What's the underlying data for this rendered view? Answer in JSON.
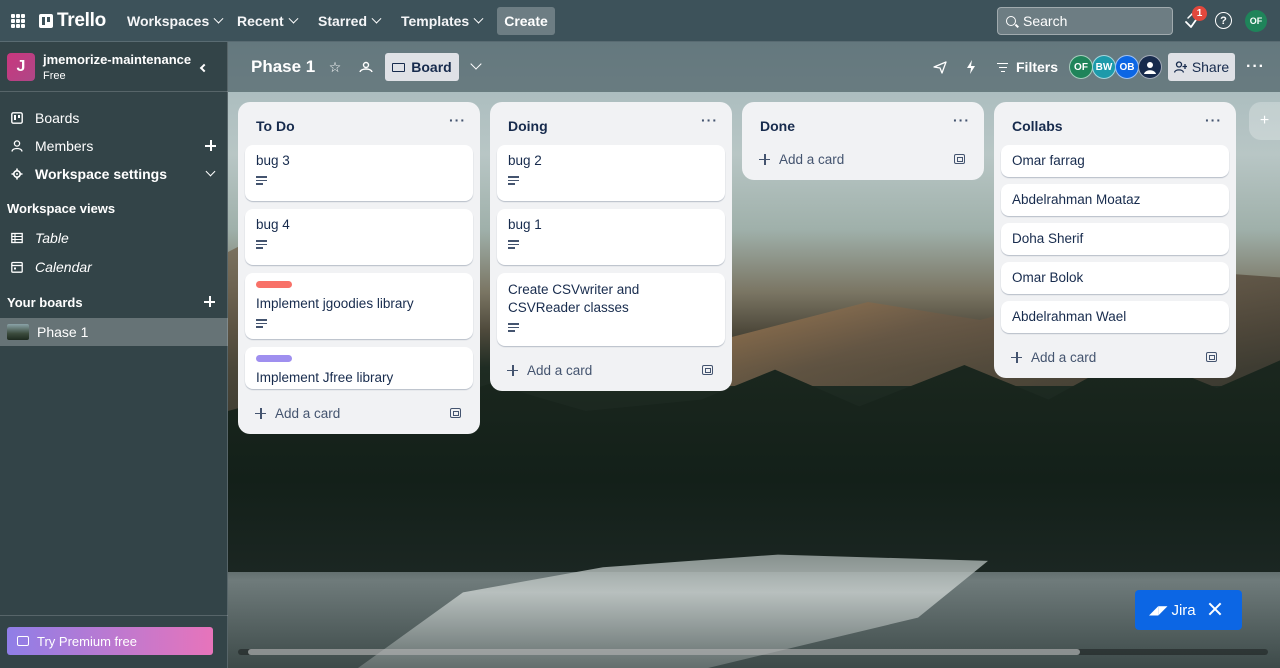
{
  "topbar": {
    "logo": "Trello",
    "menus": [
      "Workspaces",
      "Recent",
      "Starred",
      "Templates"
    ],
    "create_label": "Create",
    "search_placeholder": "Search",
    "notification_count": "1",
    "help_glyph": "?",
    "user_initials": "OF",
    "icons": [
      "apps-grid-icon",
      "trello-logo-icon",
      "search-icon",
      "notification-icon",
      "help-icon"
    ]
  },
  "sidebar": {
    "workspace_initial": "J",
    "workspace_name": "jmemorize-maintenance",
    "workspace_plan": "Free",
    "items": [
      {
        "label": "Boards",
        "icon": "boards-icon"
      },
      {
        "label": "Members",
        "icon": "member-icon"
      },
      {
        "label": "Workspace settings",
        "icon": "gear-icon"
      }
    ],
    "views_heading": "Workspace views",
    "views": [
      {
        "label": "Table",
        "icon": "table-icon"
      },
      {
        "label": "Calendar",
        "icon": "calendar-icon"
      }
    ],
    "your_boards_heading": "Your boards",
    "boards": [
      {
        "label": "Phase 1"
      }
    ],
    "premium_label": "Try Premium free"
  },
  "board_header": {
    "title": "Phase 1",
    "view_label": "Board",
    "filters_label": "Filters",
    "members": [
      {
        "initials": "OF",
        "color": "#1f845a"
      },
      {
        "initials": "BW",
        "color": "#1d9aaa"
      },
      {
        "initials": "OB",
        "color": "#0c66e4"
      },
      {
        "initials": "",
        "color": "#172b4d"
      }
    ],
    "share_label": "Share",
    "more_label": "···"
  },
  "lists": [
    {
      "title": "To Do",
      "menu": "···",
      "cards": [
        {
          "title": "bug 3",
          "has_description": true
        },
        {
          "title": "bug 4",
          "has_description": true
        },
        {
          "title": "Implement jgoodies library",
          "label_color": "#f87168",
          "has_description": true
        },
        {
          "title": "Implement Jfree library",
          "label_color": "#9f8fef",
          "has_description": false
        }
      ],
      "add_card": "Add a card"
    },
    {
      "title": "Doing",
      "menu": "···",
      "cards": [
        {
          "title": "bug 2",
          "has_description": true
        },
        {
          "title": "bug 1",
          "has_description": true
        },
        {
          "title": "Create CSVwriter and CSVReader classes",
          "has_description": true
        }
      ],
      "add_card": "Add a card"
    },
    {
      "title": "Done",
      "menu": "···",
      "cards": [],
      "add_card": "Add a card"
    },
    {
      "title": "Collabs",
      "menu": "···",
      "cards": [
        {
          "title": "Omar farrag"
        },
        {
          "title": "Abdelrahman Moataz"
        },
        {
          "title": "Doha Sherif"
        },
        {
          "title": "Omar Bolok"
        },
        {
          "title": "Abdelrahman Wael"
        }
      ],
      "add_card": "Add a card"
    }
  ],
  "add_list_glyph": "+",
  "jira": {
    "label": "Jira"
  }
}
